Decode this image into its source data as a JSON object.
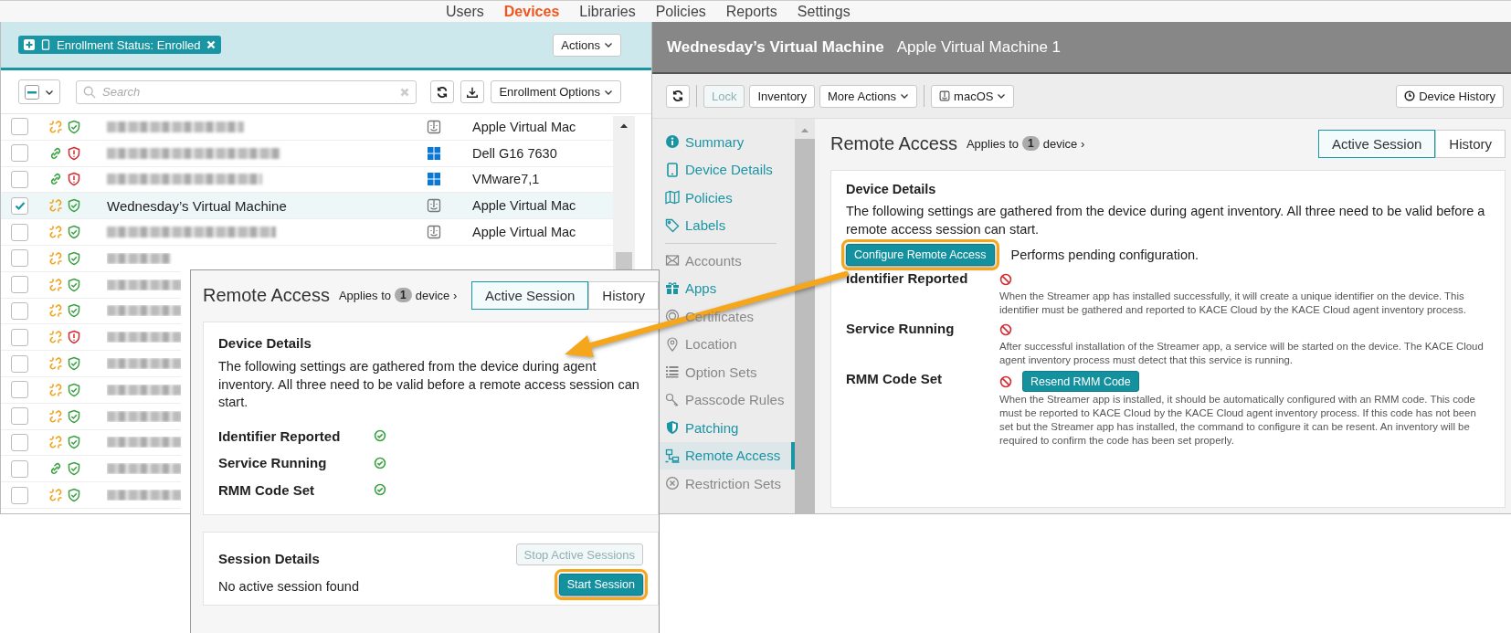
{
  "nav": [
    {
      "label": "Users",
      "selected": false
    },
    {
      "label": "Devices",
      "selected": true
    },
    {
      "label": "Libraries",
      "selected": false
    },
    {
      "label": "Policies",
      "selected": false
    },
    {
      "label": "Reports",
      "selected": false
    },
    {
      "label": "Settings",
      "selected": false
    }
  ],
  "filter_bar": {
    "chip": "Enrollment Status: Enrolled",
    "actions_button": "Actions"
  },
  "list_toolbar": {
    "search_placeholder": "Search",
    "enrollment_options": "Enrollment Options"
  },
  "devices": [
    {
      "linked": false,
      "secure": true,
      "checked": false,
      "kind": "mac",
      "model": "Apple Virtual Mac"
    },
    {
      "linked": true,
      "secure": false,
      "checked": false,
      "kind": "windows",
      "model": "Dell G16 7630"
    },
    {
      "linked": true,
      "secure": false,
      "checked": false,
      "kind": "windows",
      "model": "VMware7,1"
    },
    {
      "linked": false,
      "secure": true,
      "checked": true,
      "name": "Wednesday’s Virtual Machine",
      "kind": "mac",
      "model": "Apple Virtual Mac"
    },
    {
      "linked": false,
      "secure": true,
      "checked": false,
      "kind": "mac",
      "model": "Apple Virtual Mac"
    },
    {
      "linked": false,
      "secure": true,
      "checked": false
    },
    {
      "linked": false,
      "secure": true,
      "checked": false
    },
    {
      "linked": false,
      "secure": true,
      "checked": false
    },
    {
      "linked": false,
      "secure": false,
      "checked": false
    },
    {
      "linked": false,
      "secure": true,
      "checked": false
    },
    {
      "linked": false,
      "secure": true,
      "checked": false
    },
    {
      "linked": false,
      "secure": true,
      "checked": false
    },
    {
      "linked": false,
      "secure": true,
      "checked": false
    },
    {
      "linked": true,
      "secure": true,
      "checked": false
    },
    {
      "linked": false,
      "secure": true,
      "checked": false
    }
  ],
  "device_panel": {
    "title": "Wednesday’s Virtual Machine",
    "subtitle": "Apple Virtual Machine 1",
    "toolbar": [
      {
        "kind": "refresh"
      },
      {
        "kind": "button",
        "label": "Lock",
        "disabled": true
      },
      {
        "kind": "button",
        "label": "Inventory",
        "disabled": false
      },
      {
        "kind": "menu",
        "label": "More Actions",
        "disabled": false
      },
      {
        "kind": "os_menu",
        "label": "macOS",
        "disabled": false
      }
    ],
    "device_history": "Device History",
    "sidebar": {
      "groups": [
        {
          "items": [
            {
              "label": "Summary",
              "disabled": false,
              "selected": false
            },
            {
              "label": "Device Details",
              "disabled": false,
              "selected": false
            },
            {
              "label": "Policies",
              "disabled": false,
              "selected": false
            },
            {
              "label": "Labels",
              "disabled": false,
              "selected": false
            }
          ]
        },
        {
          "items": [
            {
              "label": "Accounts",
              "disabled": true,
              "selected": false
            },
            {
              "label": "Apps",
              "disabled": false,
              "selected": false
            },
            {
              "label": "Certificates",
              "disabled": true,
              "selected": false
            },
            {
              "label": "Location",
              "disabled": true,
              "selected": false
            },
            {
              "label": "Option Sets",
              "disabled": true,
              "selected": false
            },
            {
              "label": "Passcode Rules",
              "disabled": true,
              "selected": false
            },
            {
              "label": "Patching",
              "disabled": false,
              "selected": false
            },
            {
              "label": "Remote Access",
              "disabled": false,
              "selected": true
            },
            {
              "label": "Restriction Sets",
              "disabled": true,
              "selected": false
            }
          ]
        }
      ]
    },
    "remote_access": {
      "title": "Remote Access",
      "applies_prefix": "Applies to",
      "count": "1",
      "applies_suffix": "device ›",
      "tabs": [
        {
          "label": "Active Session",
          "selected": true
        },
        {
          "label": "History",
          "selected": false
        }
      ],
      "card_title": "Device Details",
      "description": "The following settings are gathered from the device during agent inventory. All three need to be valid before a remote access session can start.",
      "configure_button": {
        "label": "Configure Remote Access",
        "highlighted": true
      },
      "configure_note": "Performs pending configuration.",
      "checks": [
        {
          "label": "Identifier Reported",
          "valid": false,
          "note": "When the Streamer app has installed successfully, it will create a unique identifier on the device. This identifier must be gathered and reported to KACE Cloud by the KACE Cloud agent inventory process."
        },
        {
          "label": "Service Running",
          "valid": false,
          "note": "After successful installation of the Streamer app, a service will be started on the device. The KACE Cloud agent inventory process must detect that this service is running."
        },
        {
          "label": "RMM Code Set",
          "valid": false,
          "action": "Resend RMM Code",
          "note": "When the Streamer app is installed, it should be automatically configured with an RMM code. This code must be reported to KACE Cloud by the KACE Cloud agent inventory process. If this code has not been set but the Streamer app has installed, the command to configure it can be resent. An inventory will be required to confirm the code has been set properly."
        }
      ]
    }
  },
  "popup": {
    "title": "Remote Access",
    "applies_prefix": "Applies to",
    "count": "1",
    "applies_suffix": "device ›",
    "tabs": [
      {
        "label": "Active Session",
        "selected": true
      },
      {
        "label": "History",
        "selected": false
      }
    ],
    "card_title": "Device Details",
    "description": "The following settings are gathered from the device during agent inventory. All three need to be valid before a remote access session can start.",
    "checks": [
      {
        "label": "Identifier Reported",
        "valid": true
      },
      {
        "label": "Service Running",
        "valid": true
      },
      {
        "label": "RMM Code Set",
        "valid": true
      }
    ],
    "session": {
      "title": "Session Details",
      "stop_button": {
        "label": "Stop Active Sessions",
        "disabled": true
      },
      "message": "No active session found",
      "start_button": {
        "label": "Start Session",
        "highlighted": true
      }
    }
  }
}
